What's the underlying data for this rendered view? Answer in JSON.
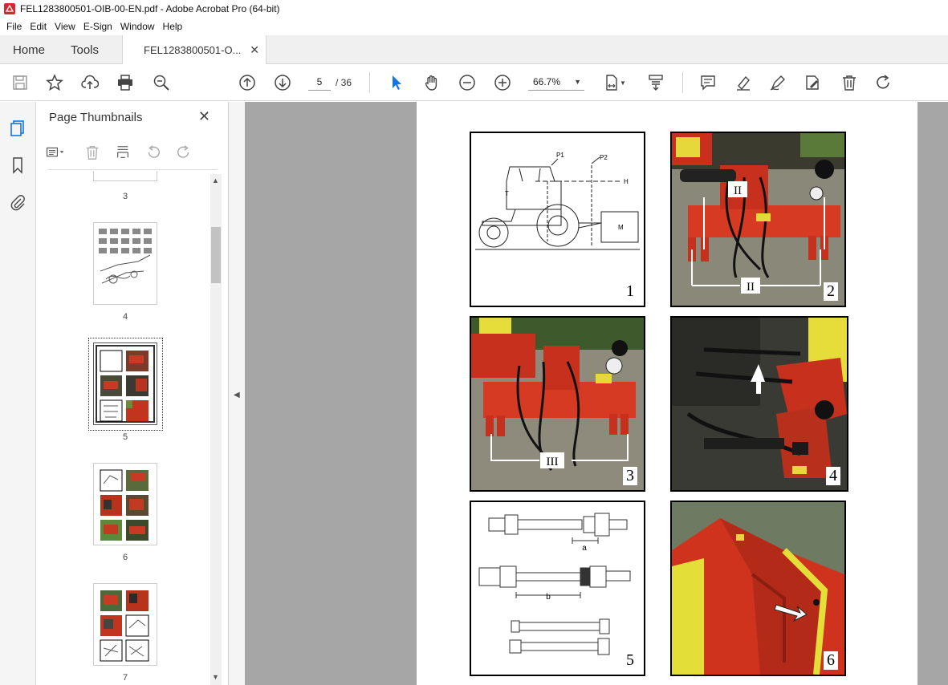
{
  "window": {
    "title": "FEL1283800501-OIB-00-EN.pdf - Adobe Acrobat Pro (64-bit)"
  },
  "menu": [
    "File",
    "Edit",
    "View",
    "E-Sign",
    "Window",
    "Help"
  ],
  "tabs": {
    "home": "Home",
    "tools": "Tools",
    "document": "FEL1283800501-O..."
  },
  "toolbar": {
    "current_page": "5",
    "total_pages": "/ 36",
    "zoom": "66.7%"
  },
  "sidebar": {
    "title": "Page Thumbnails",
    "thumbnails": [
      {
        "label": "3"
      },
      {
        "label": "4"
      },
      {
        "label": "5"
      },
      {
        "label": "6"
      },
      {
        "label": "7"
      }
    ]
  },
  "page": {
    "figures": [
      {
        "number": "1",
        "kind": "drawing",
        "labels": [
          "P1",
          "P2",
          "H",
          "T",
          "M"
        ]
      },
      {
        "number": "2",
        "kind": "photo",
        "labels": [
          "II",
          "II"
        ]
      },
      {
        "number": "3",
        "kind": "photo",
        "labels": [
          "III"
        ]
      },
      {
        "number": "4",
        "kind": "photo",
        "labels": []
      },
      {
        "number": "5",
        "kind": "drawing",
        "labels": [
          "a",
          "b"
        ]
      },
      {
        "number": "6",
        "kind": "photo",
        "labels": []
      }
    ]
  },
  "colors": {
    "accent": "#1473e6",
    "doc_bg": "#a6a6a6",
    "machine_red": "#d8321e",
    "safety_yellow": "#f0e020"
  }
}
